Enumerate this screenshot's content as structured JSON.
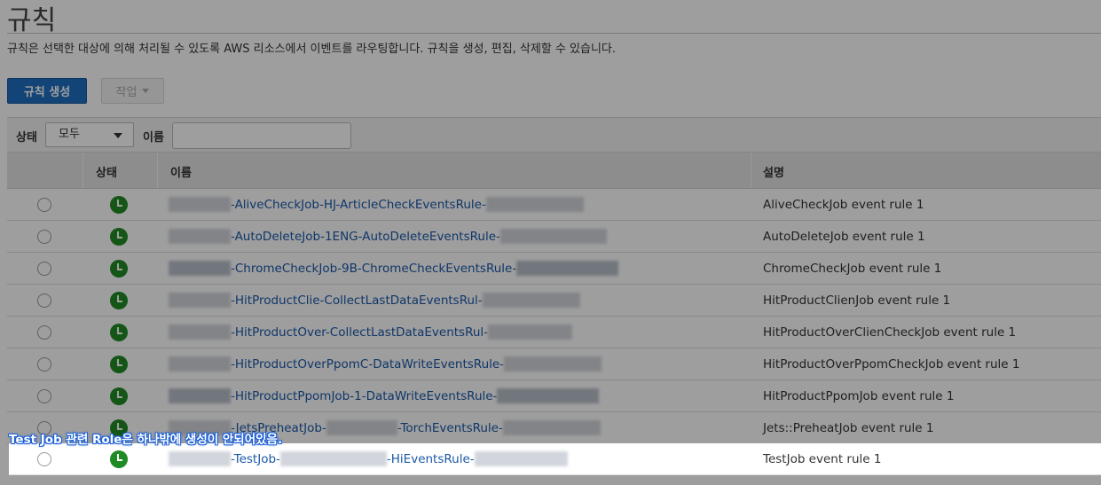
{
  "page": {
    "title": "규칙",
    "description": "규칙은 선택한 대상에 의해 처리될 수 있도록 AWS 리소스에서 이벤트를 라우팅합니다. 규칙을 생성, 편집, 삭제할 수 있습니다."
  },
  "toolbar": {
    "create_label": "규칙 생성",
    "actions_label": "작업"
  },
  "filter": {
    "status_label": "상태",
    "status_value": "모두",
    "name_label": "이름",
    "name_value": ""
  },
  "table": {
    "columns": [
      "상태",
      "이름",
      "설명"
    ],
    "status_color": "#1f8b24",
    "rows": [
      {
        "name": "-AliveCheckJob-HJ-ArticleCheckEventsRule-",
        "description": "AliveCheckJob event rule 1"
      },
      {
        "name": "-AutoDeleteJob-1ENG-AutoDeleteEventsRule-",
        "description": "AutoDeleteJob event rule 1"
      },
      {
        "name": "-ChromeCheckJob-9B-ChromeCheckEventsRule-",
        "description": "ChromeCheckJob event rule 1"
      },
      {
        "name": "-HitProductClie-CollectLastDataEventsRul-",
        "description": "HitProductClienJob event rule 1"
      },
      {
        "name": "-HitProductOver-CollectLastDataEventsRul-",
        "description": "HitProductOverClienCheckJob event rule 1"
      },
      {
        "name": "-HitProductOverPpomC-DataWriteEventsRule-",
        "description": "HitProductOverPpomCheckJob event rule 1"
      },
      {
        "name": "-HitProductPpomJob-1-DataWriteEventsRule-",
        "description": "HitProductPpomJob event rule 1"
      },
      {
        "name_a": "-JetsPreheatJob-",
        "name_b": "-TorchEventsRule-",
        "description": "Jets::PreheatJob event rule 1"
      }
    ],
    "highlighted_row": {
      "name_a": "-TestJob-",
      "name_b": "-HiEventsRule-",
      "description": "TestJob event rule 1"
    }
  },
  "annotation": {
    "text": "Test Job 관련 Role은 하나밖에 생성이 안되어있음.",
    "color": "#1b5fd6"
  }
}
